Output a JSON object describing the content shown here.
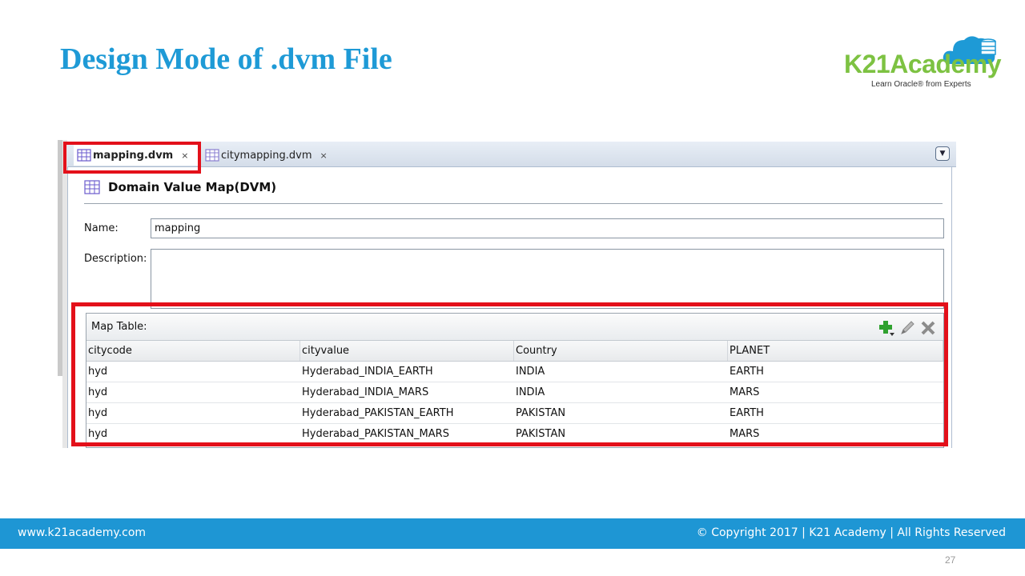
{
  "slide": {
    "title": "Design Mode of .dvm File",
    "page_number": "27"
  },
  "logo": {
    "name": "K21Academy",
    "tagline": "Learn Oracle® from Experts"
  },
  "ide": {
    "tabs": [
      {
        "label": "mapping.dvm",
        "close": "×",
        "active": true
      },
      {
        "label": "citymapping.dvm",
        "close": "×",
        "active": false
      }
    ],
    "editor": {
      "header": "Domain Value Map(DVM)",
      "name_label": "Name:",
      "name_value": "mapping",
      "description_label": "Description:",
      "description_value": ""
    },
    "map_table": {
      "title": "Map Table:",
      "columns": [
        "citycode",
        "cityvalue",
        "Country",
        "PLANET"
      ],
      "rows": [
        [
          "hyd",
          "Hyderabad_INDIA_EARTH",
          "INDIA",
          "EARTH"
        ],
        [
          "hyd",
          "Hyderabad_INDIA_MARS",
          "INDIA",
          "MARS"
        ],
        [
          "hyd",
          "Hyderabad_PAKISTAN_EARTH",
          "PAKISTAN",
          "EARTH"
        ],
        [
          "hyd",
          "Hyderabad_PAKISTAN_MARS",
          "PAKISTAN",
          "MARS"
        ]
      ],
      "toolbar_icons": [
        "add-icon",
        "edit-icon",
        "delete-icon"
      ]
    }
  },
  "footer": {
    "website": "www.k21academy.com",
    "copyright": "© Copyright 2017 | K21 Academy | All Rights Reserved"
  },
  "colors": {
    "title_blue": "#1e9ad6",
    "footer_blue": "#1e96d4",
    "highlight_red": "#e3101a",
    "logo_green": "#7dc242"
  }
}
